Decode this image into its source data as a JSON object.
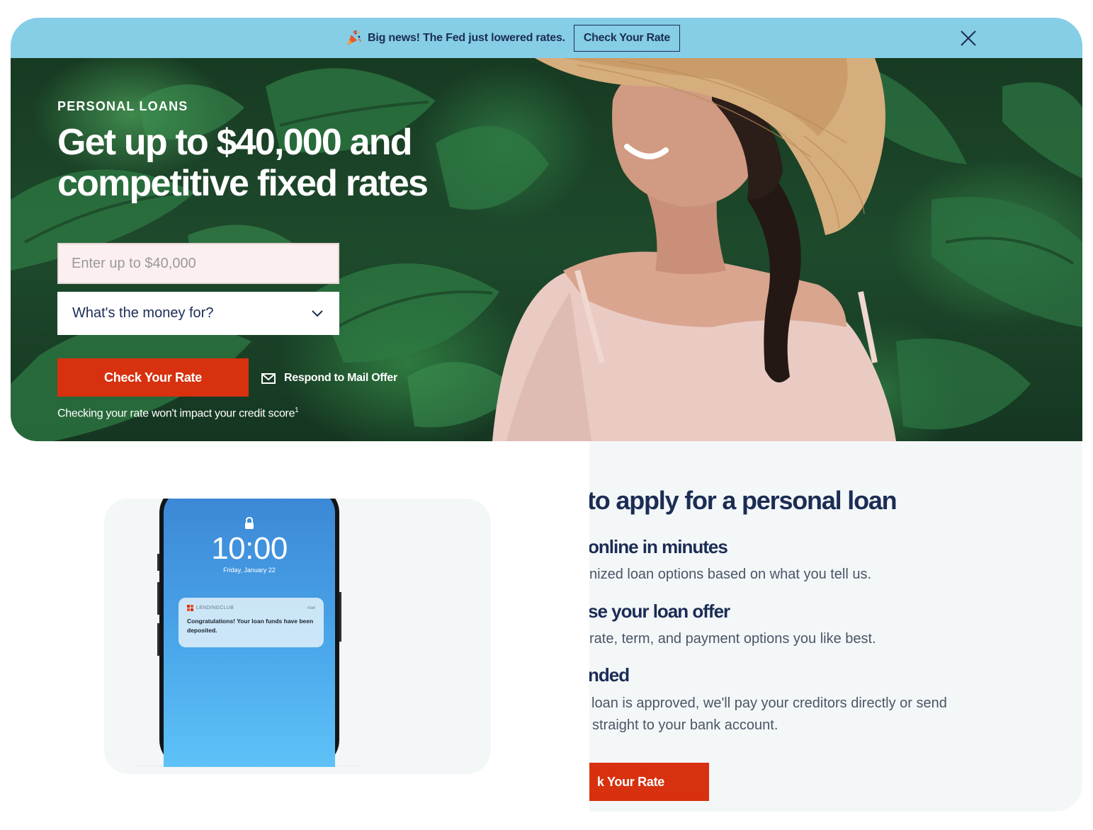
{
  "banner": {
    "text": "Big news! The Fed just lowered rates.",
    "button_label": "Check Your Rate",
    "icon": "party-popper-icon",
    "close_icon": "close-icon"
  },
  "hero": {
    "eyebrow": "PERSONAL LOANS",
    "title": "Get up to $40,000 and competitive fixed rates",
    "amount_input": {
      "value": "",
      "placeholder": "Enter up to $40,000"
    },
    "purpose_select": {
      "label": "What's the money for?",
      "icon": "chevron-down-icon"
    },
    "cta_label": "Check Your Rate",
    "mail_offer_label": "Respond to Mail Offer",
    "mail_icon": "envelope-icon",
    "disclaimer": "Checking your rate won't impact your credit score",
    "disclaimer_footnote": "1"
  },
  "phone": {
    "time": "10:00",
    "date": "Friday, January 22",
    "notification": {
      "app": "LENDINGCLUB",
      "time": "now",
      "message": "Congratulations! Your loan funds have been deposited."
    }
  },
  "steps": {
    "title": "to apply for a personal loan",
    "items": [
      {
        "heading": "online in minutes",
        "body": "nized loan options based on what you tell us."
      },
      {
        "heading": "se your loan offer",
        "body": "rate, term, and payment options you like best."
      },
      {
        "heading": "nded",
        "body_line1": "loan is approved, we'll pay your creditors directly or send",
        "body_line2": "straight to your bank account."
      }
    ],
    "cta_label": "k Your Rate"
  },
  "colors": {
    "banner_bg": "#86cde6",
    "navy": "#1b2d55",
    "cta_red": "#d7310f",
    "panel_bg": "#f4f7f8"
  }
}
